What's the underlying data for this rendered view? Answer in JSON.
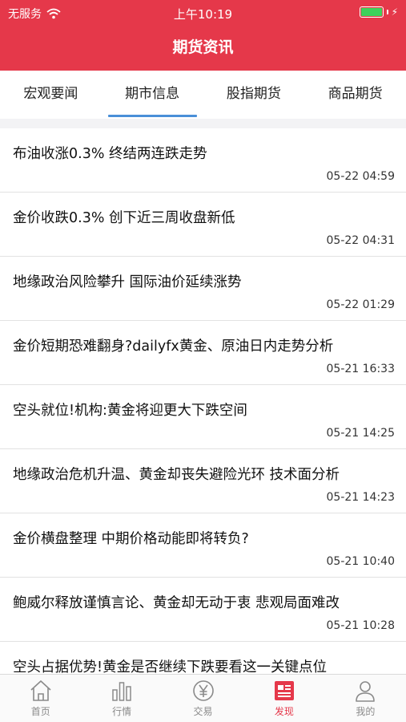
{
  "status": {
    "carrier": "无服务",
    "time": "上午10:19"
  },
  "header": {
    "title": "期货资讯"
  },
  "tabs": [
    "宏观要闻",
    "期市信息",
    "股指期货",
    "商品期货"
  ],
  "news": [
    {
      "title": "布油收涨0.3% 终结两连跌走势",
      "time": "05-22 04:59"
    },
    {
      "title": "金价收跌0.3% 创下近三周收盘新低",
      "time": "05-22 04:31"
    },
    {
      "title": "地缘政治风险攀升 国际油价延续涨势",
      "time": "05-22 01:29"
    },
    {
      "title": "金价短期恐难翻身?dailyfx黄金、原油日内走势分析",
      "time": "05-21 16:33"
    },
    {
      "title": "空头就位!机构:黄金将迎更大下跌空间",
      "time": "05-21 14:25"
    },
    {
      "title": "地缘政治危机升温、黄金却丧失避险光环 技术面分析",
      "time": "05-21 14:23"
    },
    {
      "title": "金价横盘整理 中期价格动能即将转负?",
      "time": "05-21 10:40"
    },
    {
      "title": "鲍威尔释放谨慎言论、黄金却无动于衷 悲观局面难改",
      "time": "05-21 10:28"
    },
    {
      "title": "空头占据优势!黄金是否继续下跌要看这一关键点位",
      "time": ""
    }
  ],
  "tabbar": {
    "home": "首页",
    "market": "行情",
    "trade": "交易",
    "discover": "发现",
    "mine": "我的"
  },
  "colors": {
    "brand": "#e5384a",
    "tab_underline": "#4a8fd8",
    "battery": "#3ed15b"
  }
}
